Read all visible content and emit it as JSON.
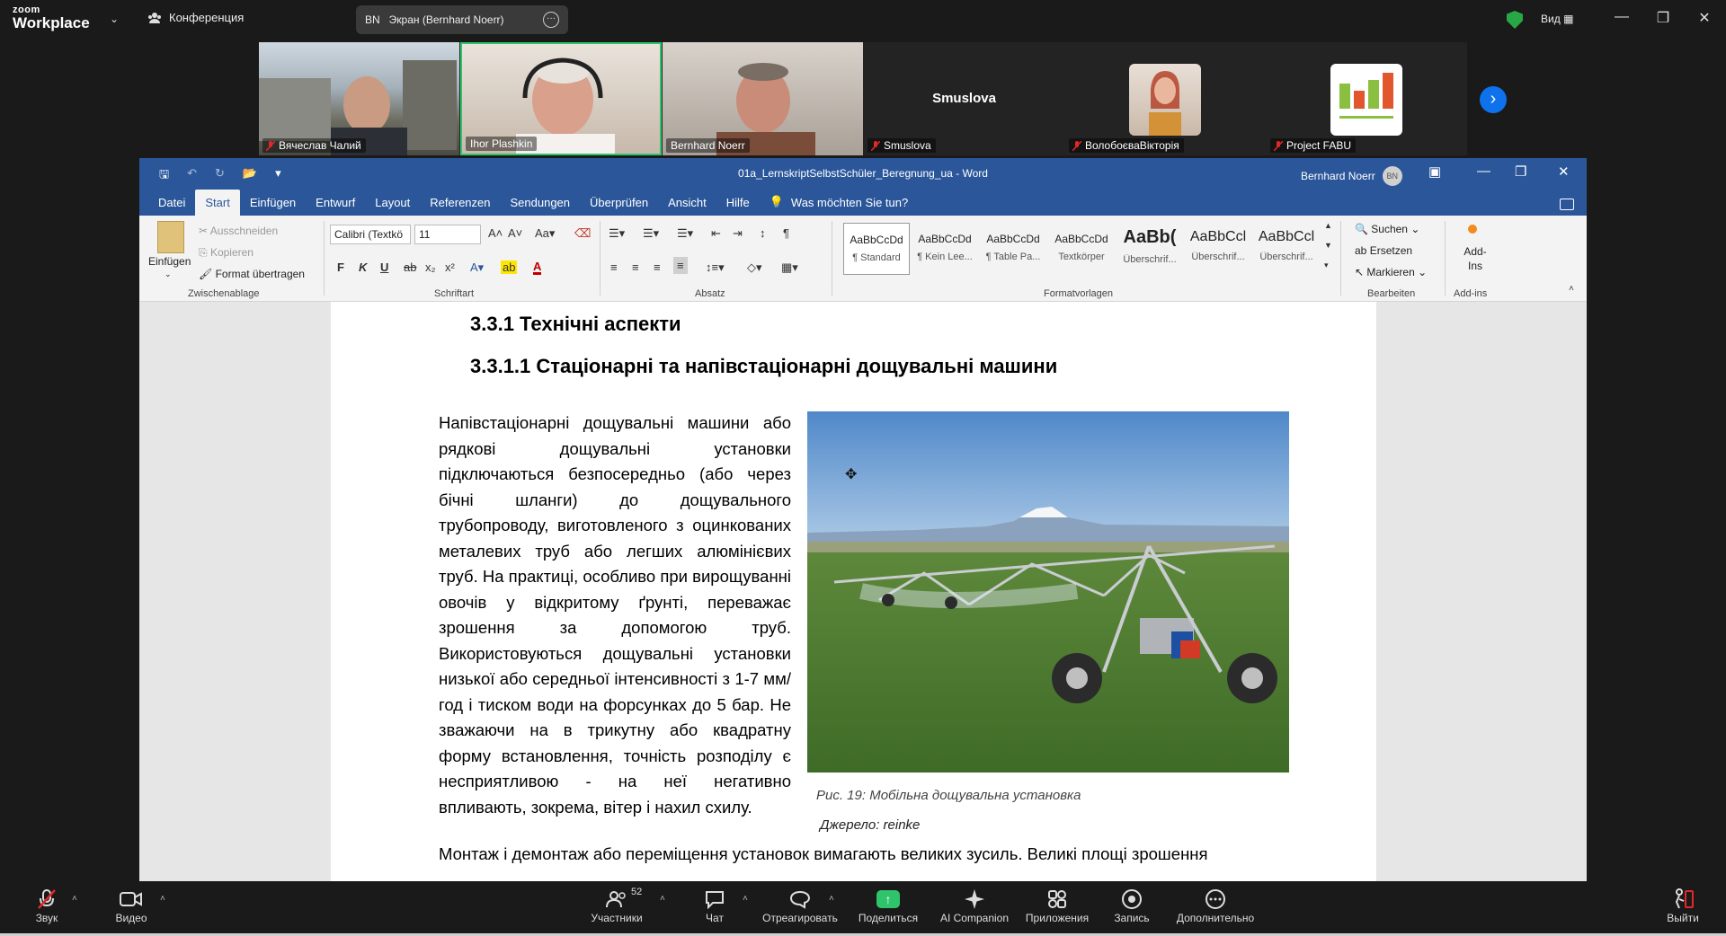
{
  "zoom": {
    "logo_small": "zoom",
    "logo_big": "Workplace",
    "meeting_label": "Конференция",
    "share_initials": "BN",
    "share_label": "Экран (Bernhard Noerr)",
    "view_label": "Вид",
    "participants": [
      {
        "name": "Вячеслав Чалий",
        "muted": true
      },
      {
        "name": "Ihor Plashkin",
        "muted": false,
        "active": true
      },
      {
        "name": "Bernhard Noerr",
        "muted": false
      },
      {
        "name": "Smuslova",
        "muted": true,
        "display_name": "Smuslova"
      },
      {
        "name": "ВолобоєваВікторія",
        "muted": true
      },
      {
        "name": "Project FABU",
        "muted": true
      }
    ],
    "toolbar": {
      "audio": "Звук",
      "video": "Видео",
      "participants": "Участники",
      "participants_count": "52",
      "chat": "Чат",
      "react": "Отреагировать",
      "share": "Поделиться",
      "companion": "AI Companion",
      "apps": "Приложения",
      "record": "Запись",
      "more": "Дополнительно",
      "leave": "Выйти"
    }
  },
  "word": {
    "title": "01a_LernskriptSelbstSchüler_Beregnung_ua  -  Word",
    "user": "Bernhard Noerr",
    "user_initials": "BN",
    "menu": [
      "Datei",
      "Start",
      "Einfügen",
      "Entwurf",
      "Layout",
      "Referenzen",
      "Sendungen",
      "Überprüfen",
      "Ansicht",
      "Hilfe"
    ],
    "active_menu": "Start",
    "tell_me": "Was möchten Sie tun?",
    "clipboard": {
      "paste": "Einfügen",
      "cut": "Ausschneiden",
      "copy": "Kopieren",
      "format_painter": "Format übertragen",
      "group": "Zwischenablage"
    },
    "font": {
      "name": "Calibri (Textkö",
      "size": "11",
      "group": "Schriftart",
      "bold": "F",
      "italic": "K",
      "underline": "U"
    },
    "paragraph_group": "Absatz",
    "styles": [
      {
        "preview": "AaBbCcDd",
        "name": "¶ Standard"
      },
      {
        "preview": "AaBbCcDd",
        "name": "¶ Kein Lee..."
      },
      {
        "preview": "AaBbCcDd",
        "name": "¶ Table Pa..."
      },
      {
        "preview": "AaBbCcDd",
        "name": "Textkörper"
      },
      {
        "preview": "AaBb(",
        "name": "Überschrif..."
      },
      {
        "preview": "AaBbCcl",
        "name": "Überschrif..."
      },
      {
        "preview": "AaBbCcl",
        "name": "Überschrif..."
      }
    ],
    "styles_group": "Formatvorlagen",
    "editing": {
      "find": "Suchen",
      "replace": "Ersetzen",
      "select": "Markieren",
      "group": "Bearbeiten"
    },
    "addins": {
      "label": "Add-Ins",
      "group": "Add-ins"
    }
  },
  "document": {
    "heading1": "3.3.1   Технічні аспекти",
    "heading2": "3.3.1.1     Стаціонарні та напівстаціонарні дощувальні машини",
    "paragraph": "Напівстаціонарні дощувальні машини або рядкові дощувальні установки підключаються безпосередньо (або через бічні шланги) до дощувального трубопроводу, виготовленого з оцинкованих металевих труб або легших алюмінієвих труб. На практиці, особливо при вирощуванні овочів у відкритому ґрунті, переважає зрошення за допомогою труб. Використовуються дощувальні установки низької або середньої інтенсивності з 1-7 мм/год і тиском води на форсунках до 5 бар. Не зважаючи на в трикутну або квадратну форму встановлення, точність розподілу є несприятливою - на неї негативно впливають, зокрема, вітер і нахил схилу.",
    "paragraph_end": "Монтаж і демонтаж або переміщення установок вимагають великих зусиль. Великі площі зрошення",
    "caption": "Рис. 19: Мобільна дощувальна установка",
    "source": "Джерело: reinke"
  }
}
